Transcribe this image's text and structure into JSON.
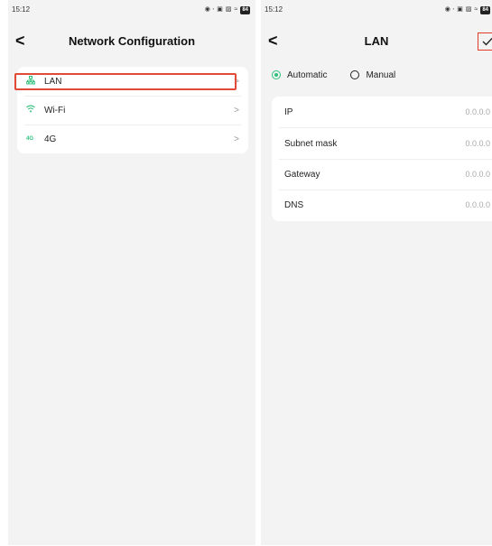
{
  "left_screen": {
    "status_bar": {
      "time": "15:12",
      "battery": "84"
    },
    "nav": {
      "back": "<",
      "title": "Network Configuration"
    },
    "items": [
      {
        "label": "LAN",
        "icon": "lan-icon",
        "chevron": ">"
      },
      {
        "label": "Wi-Fi",
        "icon": "wifi-icon",
        "chevron": ">"
      },
      {
        "label": "4G",
        "icon": "cellular-4g-icon",
        "icon_text": "4G",
        "chevron": ">"
      }
    ],
    "selected_item": "LAN"
  },
  "right_screen": {
    "status_bar": {
      "time": "15:12",
      "battery": "84"
    },
    "nav": {
      "back": "<",
      "title": "LAN",
      "confirm_icon": "check-icon"
    },
    "modes": [
      {
        "label": "Automatic",
        "selected": true
      },
      {
        "label": "Manual",
        "selected": false
      }
    ],
    "fields": [
      {
        "label": "IP",
        "value": "0.0.0.0"
      },
      {
        "label": "Subnet mask",
        "value": "0.0.0.0"
      },
      {
        "label": "Gateway",
        "value": "0.0.0.0"
      },
      {
        "label": "DNS",
        "value": "0.0.0.0"
      }
    ]
  },
  "colors": {
    "accent": "#2fc07c",
    "highlight": "#e24a35",
    "background": "#f3f3f3"
  }
}
